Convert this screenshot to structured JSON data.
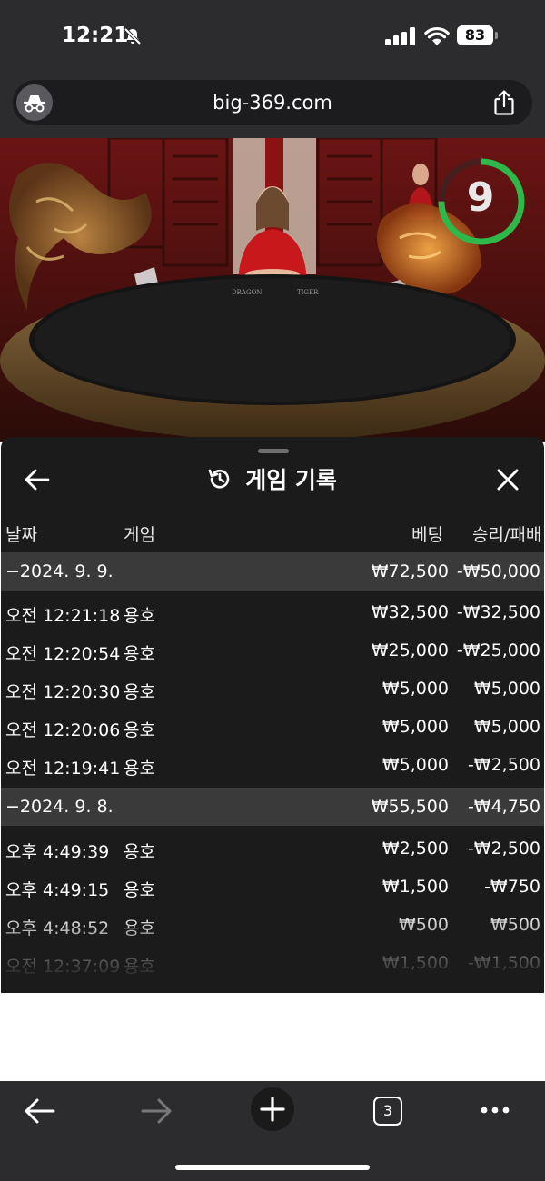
{
  "status_bar": {
    "time": "12:21",
    "battery": "83"
  },
  "browser": {
    "url": "big-369.com",
    "tab_count": "3"
  },
  "video": {
    "timer": "9",
    "timer_progress": 0.75
  },
  "panel": {
    "title": "게임 기록",
    "columns": {
      "date": "날짜",
      "game": "게임",
      "bet": "베팅",
      "result": "승리/패배"
    },
    "rows": [
      {
        "type": "group",
        "date": "−2024. 9. 9.",
        "game": "",
        "bet": "₩72,500",
        "result": "-₩50,000"
      },
      {
        "type": "item",
        "date": "오전 12:21:18",
        "game": "용호",
        "bet": "₩32,500",
        "result": "-₩32,500"
      },
      {
        "type": "item",
        "date": "오전 12:20:54",
        "game": "용호",
        "bet": "₩25,000",
        "result": "-₩25,000"
      },
      {
        "type": "item",
        "date": "오전 12:20:30",
        "game": "용호",
        "bet": "₩5,000",
        "result": "₩5,000"
      },
      {
        "type": "item",
        "date": "오전 12:20:06",
        "game": "용호",
        "bet": "₩5,000",
        "result": "₩5,000"
      },
      {
        "type": "item",
        "date": "오전 12:19:41",
        "game": "용호",
        "bet": "₩5,000",
        "result": "-₩2,500"
      },
      {
        "type": "group",
        "date": "−2024. 9. 8.",
        "game": "",
        "bet": "₩55,500",
        "result": "-₩4,750"
      },
      {
        "type": "item",
        "date": "오후 4:49:39",
        "game": "용호",
        "bet": "₩2,500",
        "result": "-₩2,500"
      },
      {
        "type": "item",
        "date": "오후 4:49:15",
        "game": "용호",
        "bet": "₩1,500",
        "result": "-₩750"
      },
      {
        "type": "item",
        "date": "오후 4:48:52",
        "game": "용호",
        "bet": "₩500",
        "result": "₩500"
      },
      {
        "type": "item",
        "date": "오전 12:37:09",
        "game": "용호",
        "bet": "₩1,500",
        "result": "-₩1,500"
      }
    ]
  },
  "colors": {
    "panel_bg": "#1b1b1b",
    "group_row_bg": "#3a3a3a",
    "timer_ring": "#2fb84a",
    "chrome_bg": "#2c2c2e"
  },
  "icons": {
    "bell": "bell-slash-icon",
    "signal": "cellular-signal-icon",
    "wifi": "wifi-icon",
    "site": "incognito-icon",
    "share": "share-icon",
    "history": "history-icon",
    "back": "arrow-left-icon",
    "close": "close-icon",
    "forward": "arrow-right-icon",
    "new_tab": "plus-icon",
    "more": "more-horizontal-icon"
  }
}
